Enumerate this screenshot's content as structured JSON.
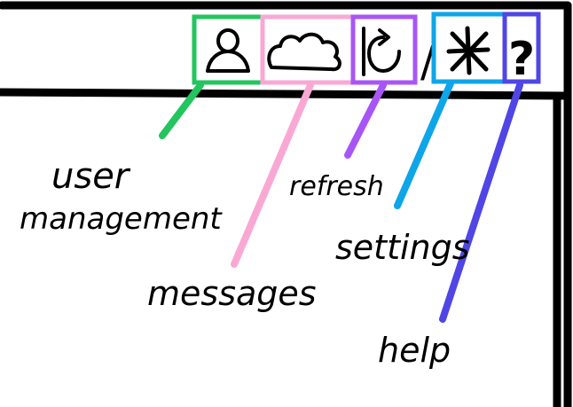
{
  "toolbar": {
    "icons": [
      {
        "id": "user",
        "icon": "user-icon",
        "label": "user management",
        "color": "#22c55e"
      },
      {
        "id": "messages",
        "icon": "cloud-icon",
        "label": "messages",
        "color": "#f9a8d4"
      },
      {
        "id": "refresh",
        "icon": "refresh-icon",
        "label": "refresh",
        "color": "#a855f7"
      },
      {
        "id": "settings",
        "icon": "asterisk-icon",
        "label": "settings",
        "color": "#0ea5e9"
      },
      {
        "id": "help",
        "icon": "question-icon",
        "label": "help",
        "color": "#4f46e5"
      }
    ],
    "separator_glyph": "/",
    "help_glyph": "?"
  },
  "labels": {
    "user_line1": "user",
    "user_line2": "management",
    "messages": "messages",
    "refresh": "refresh",
    "settings": "settings",
    "help": "help"
  }
}
